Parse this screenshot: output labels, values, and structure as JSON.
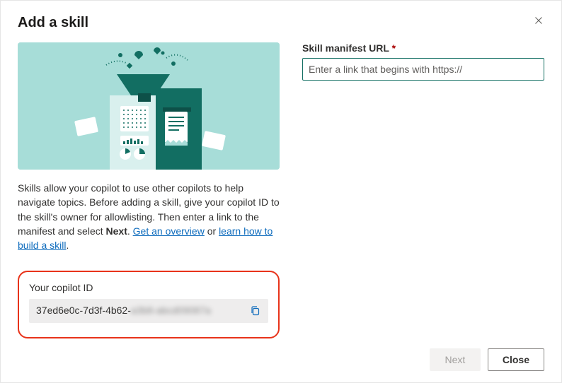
{
  "panel": {
    "title": "Add a skill",
    "description": "Skills allow your copilot to use other copilots to help navigate topics. Before adding a skill, give your copilot ID to the skill's owner for allowlisting. Then enter a link to the manifest and select ",
    "select_bold": "Next",
    "after_next": ". ",
    "link_overview": "Get an overview",
    "or_text": " or ",
    "link_build": "learn how to build a skill",
    "after_links": "."
  },
  "copilot_id": {
    "label": "Your copilot ID",
    "value_visible": "37ed6e0c-7d3f-4b62-",
    "value_redacted": "a3b8-abcd09087a"
  },
  "manifest": {
    "label": "Skill manifest URL ",
    "placeholder": "Enter a link that begins with https://"
  },
  "footer": {
    "next": "Next",
    "close": "Close"
  }
}
